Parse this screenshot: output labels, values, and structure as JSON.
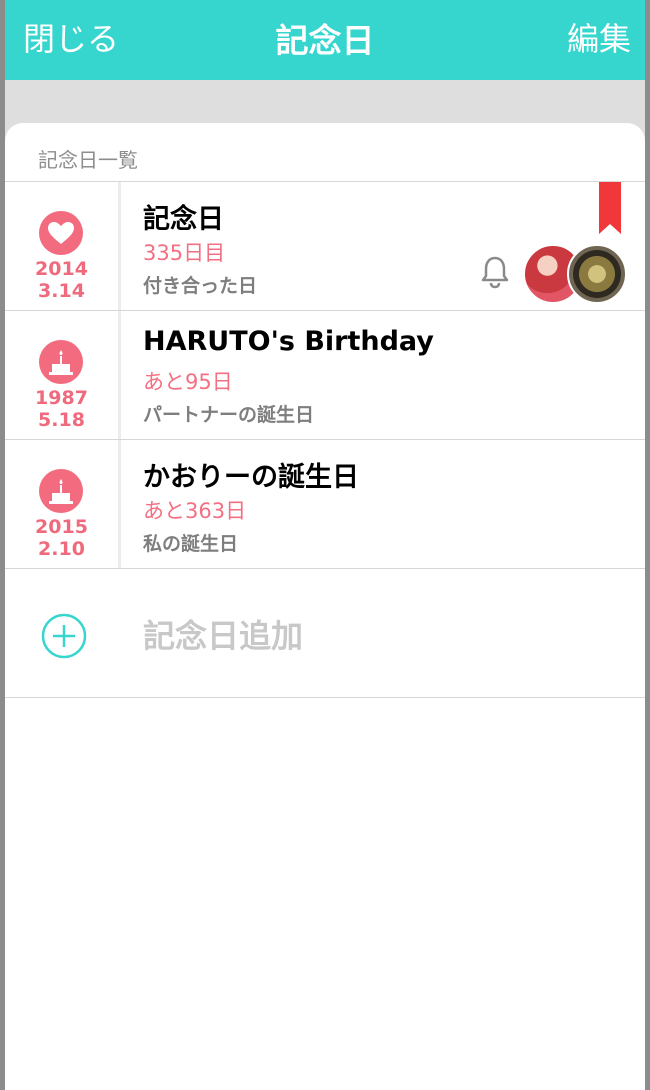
{
  "nav": {
    "close_label": "閉じる",
    "title": "記念日",
    "edit_label": "編集",
    "bg_color": "#36d6cf"
  },
  "section": {
    "header": "記念日一覧"
  },
  "anniversaries": [
    {
      "icon": "heart-icon",
      "year": "2014",
      "date": "3.14",
      "title": "記念日",
      "count": "335日目",
      "subtitle": "付き合った日",
      "bookmarked": true,
      "notification": "bell-icon",
      "avatars": [
        "partner-avatar",
        "food-avatar"
      ]
    },
    {
      "icon": "cake-icon",
      "year": "1987",
      "date": "5.18",
      "title": "HARUTO's Birthday",
      "count": "あと95日",
      "subtitle": "パートナーの誕生日"
    },
    {
      "icon": "cake-icon",
      "year": "2015",
      "date": "2.10",
      "title": "かおりーの誕生日",
      "count": "あと363日",
      "subtitle": "私の誕生日"
    }
  ],
  "add": {
    "label": "記念日追加",
    "icon": "plus-circle-icon"
  },
  "colors": {
    "accent": "#36d6cf",
    "pink": "#f26b7e",
    "bookmark": "#f0373a"
  }
}
